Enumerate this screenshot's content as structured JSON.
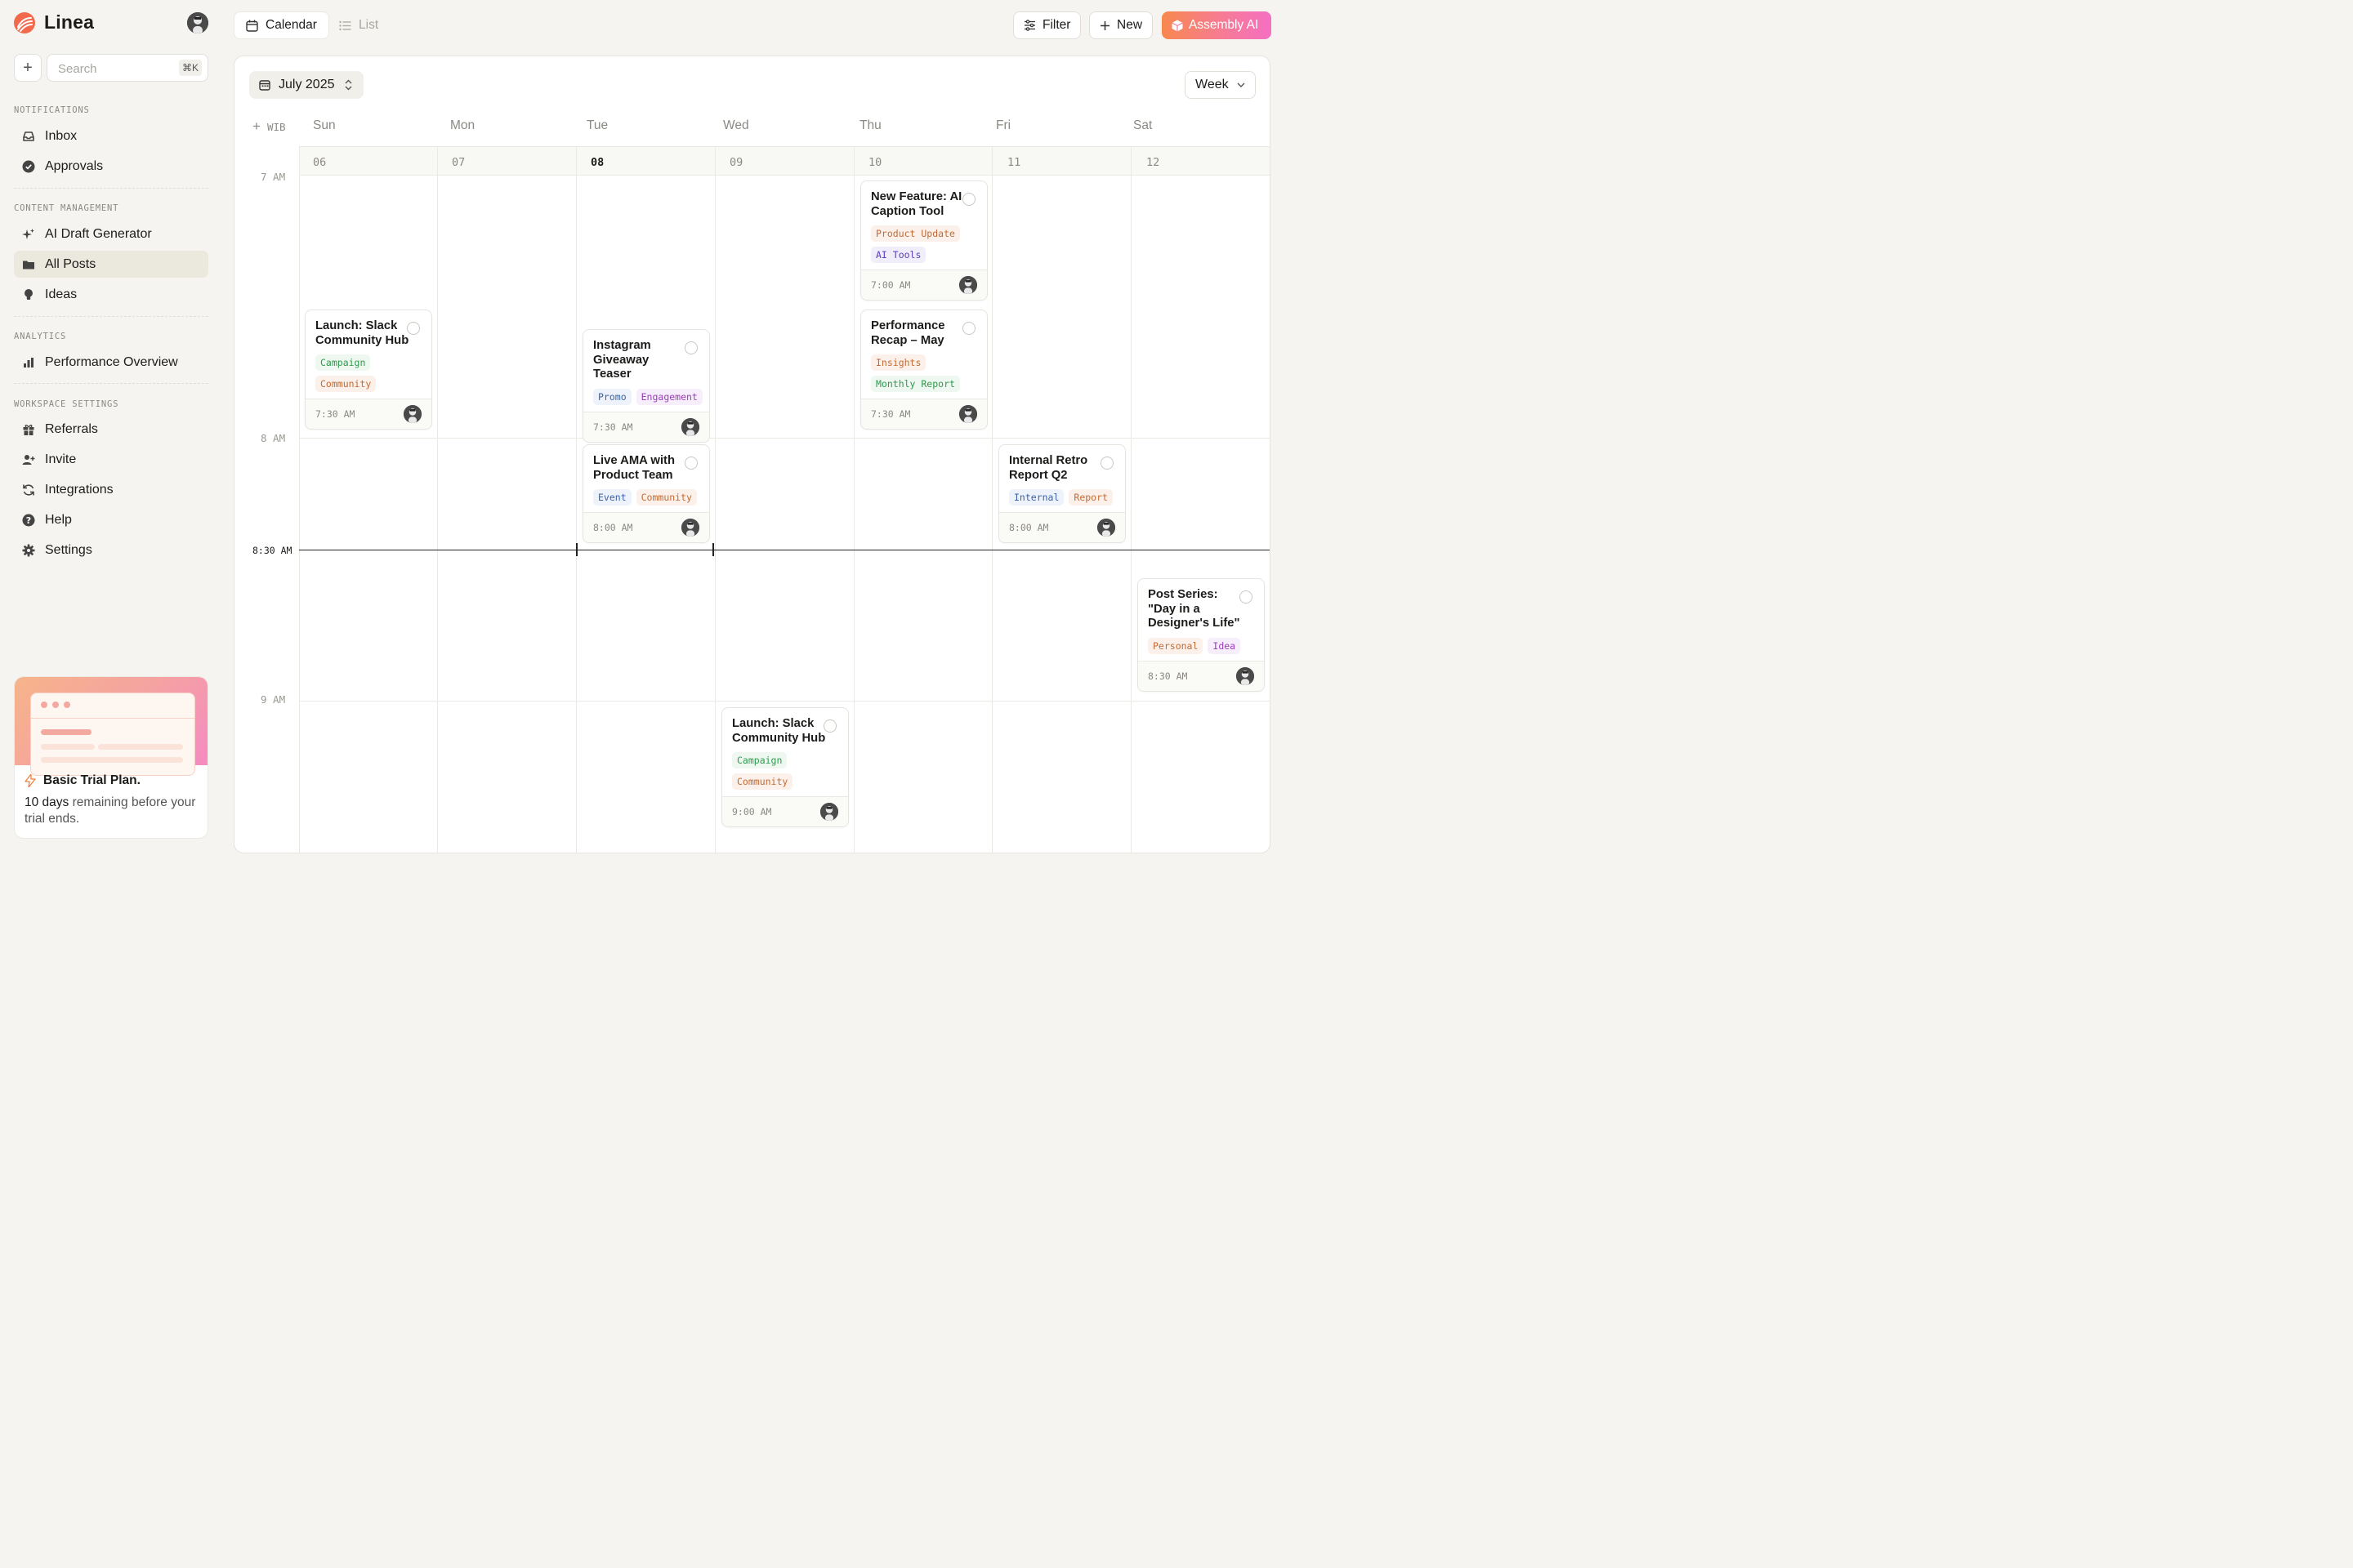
{
  "app": {
    "name": "Linea"
  },
  "sidebar": {
    "search_placeholder": "Search",
    "search_shortcut": "⌘K",
    "sections": [
      {
        "label": "NOTIFICATIONS",
        "items": [
          {
            "label": "Inbox",
            "icon": "inbox-icon"
          },
          {
            "label": "Approvals",
            "icon": "check-circle-icon"
          }
        ]
      },
      {
        "label": "CONTENT MANAGEMENT",
        "items": [
          {
            "label": "AI Draft Generator",
            "icon": "sparkle-icon"
          },
          {
            "label": "All Posts",
            "icon": "folder-icon",
            "active": true
          },
          {
            "label": "Ideas",
            "icon": "lightbulb-icon"
          }
        ]
      },
      {
        "label": "ANALYTICS",
        "items": [
          {
            "label": "Performance Overview",
            "icon": "bar-chart-icon"
          }
        ]
      },
      {
        "label": "WORKSPACE SETTINGS",
        "items": [
          {
            "label": "Referrals",
            "icon": "gift-icon"
          },
          {
            "label": "Invite",
            "icon": "user-plus-icon"
          },
          {
            "label": "Integrations",
            "icon": "refresh-icon"
          },
          {
            "label": "Help",
            "icon": "help-icon"
          },
          {
            "label": "Settings",
            "icon": "gear-icon"
          }
        ]
      }
    ],
    "trial": {
      "title": "Basic Trial Plan.",
      "days": "10 days",
      "rest": " remaining before your trial ends."
    }
  },
  "topbar": {
    "tabs": [
      {
        "label": "Calendar",
        "active": true
      },
      {
        "label": "List",
        "active": false
      }
    ],
    "filter_label": "Filter",
    "new_label": "New",
    "assembly_label": "Assembly AI"
  },
  "calendar": {
    "month_label": "July 2025",
    "view_label": "Week",
    "timezone": "WIB",
    "days": [
      {
        "dow": "Sun",
        "date": "06"
      },
      {
        "dow": "Mon",
        "date": "07"
      },
      {
        "dow": "Tue",
        "date": "08",
        "today": true
      },
      {
        "dow": "Wed",
        "date": "09"
      },
      {
        "dow": "Thu",
        "date": "10"
      },
      {
        "dow": "Fri",
        "date": "11"
      },
      {
        "dow": "Sat",
        "date": "12"
      }
    ],
    "hours": [
      "7 AM",
      "8 AM",
      "9 AM"
    ],
    "now_label": "8:30 AM",
    "events": [
      {
        "title": "Launch: Slack Community Hub",
        "tags": [
          {
            "label": "Campaign",
            "color": "#2f9a4e"
          },
          {
            "label": "Community",
            "color": "#c36b35"
          }
        ],
        "time": "7:30 AM"
      },
      {
        "title": "Instagram Giveaway Teaser",
        "tags": [
          {
            "label": "Promo",
            "color": "#3a63a8"
          },
          {
            "label": "Engagement",
            "color": "#9a3fb8"
          }
        ],
        "time": "7:30 AM"
      },
      {
        "title": "Live AMA with Product Team",
        "tags": [
          {
            "label": "Event",
            "color": "#3a63a8"
          },
          {
            "label": "Community",
            "color": "#c36b35"
          }
        ],
        "time": "8:00 AM"
      },
      {
        "title": "New Feature: AI Caption Tool",
        "tags": [
          {
            "label": "Product Update",
            "color": "#c36b35"
          },
          {
            "label": "AI Tools",
            "color": "#5a3fb8"
          }
        ],
        "time": "7:00 AM"
      },
      {
        "title": "Performance Recap – May",
        "tags": [
          {
            "label": "Insights",
            "color": "#c36b35"
          },
          {
            "label": "Monthly Report",
            "color": "#2f9a4e"
          }
        ],
        "time": "7:30 AM"
      },
      {
        "title": "Internal Retro Report Q2",
        "tags": [
          {
            "label": "Internal",
            "color": "#3a63a8"
          },
          {
            "label": "Report",
            "color": "#c36b35"
          }
        ],
        "time": "8:00 AM"
      },
      {
        "title": "Post Series: \"Day in a Designer's Life\"",
        "tags": [
          {
            "label": "Personal",
            "color": "#c36b35"
          },
          {
            "label": "Idea",
            "color": "#9a3fb8"
          }
        ],
        "time": "8:30 AM"
      },
      {
        "title": "Launch: Slack Community Hub",
        "tags": [
          {
            "label": "Campaign",
            "color": "#2f9a4e"
          },
          {
            "label": "Community",
            "color": "#c36b35"
          }
        ],
        "time": "9:00 AM"
      }
    ]
  }
}
